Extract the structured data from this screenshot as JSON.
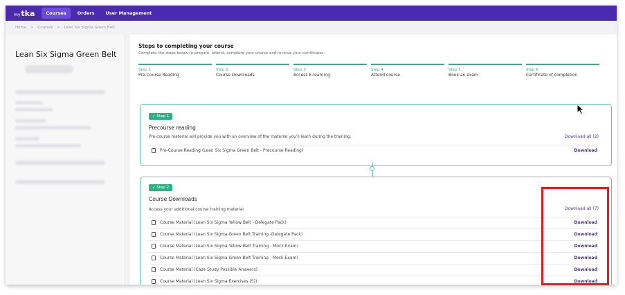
{
  "nav": {
    "logo_small": "my",
    "logo_main": "tka",
    "items": [
      {
        "label": "Courses",
        "active": true
      },
      {
        "label": "Orders",
        "active": false
      },
      {
        "label": "User Management",
        "active": false
      }
    ]
  },
  "breadcrumb": [
    "Home",
    ">",
    "Courses",
    ">",
    "Lean Six Sigma Green Belt"
  ],
  "sidebar": {
    "course_title": "Lean Six Sigma Green Belt"
  },
  "steps": {
    "title": "Steps to completing your course",
    "subtitle": "Complete the steps below to prepare, attend, complete your course and receive your certificates.",
    "items": [
      {
        "num": "Step 1",
        "name": "Pre-Course Reading"
      },
      {
        "num": "Step 2",
        "name": "Course Downloads"
      },
      {
        "num": "Step 3",
        "name": "Access E-learning"
      },
      {
        "num": "Step 4",
        "name": "Attend course"
      },
      {
        "num": "Step 5",
        "name": "Book an exam"
      },
      {
        "num": "Step 6",
        "name": "Certificate of completion"
      }
    ]
  },
  "card1": {
    "badge": "✓ Step 1",
    "title": "Precourse reading",
    "desc": "Pre-course material will provide you with an overview of the material you'll learn during the training.",
    "download_all": "Download all (2)",
    "files": [
      {
        "name": "Pre-Course Reading (Lean Six Sigma Green Belt - Precourse Reading)",
        "action": "Download"
      }
    ]
  },
  "card2": {
    "badge": "✓ Step 2",
    "title": "Course Downloads",
    "desc": "Access your additional course training material.",
    "download_all": "Download all (7)",
    "files": [
      {
        "name": "Course Material (Lean Six Sigma Yellow Belt - Delegate Pack)",
        "action": "Download"
      },
      {
        "name": "Course Material (Lean Six Sigma Green Belt Training -Delegate Pack)",
        "action": "Download"
      },
      {
        "name": "Course Material (Lean Six Sigma Yellow Belt Training - Mock Exam)",
        "action": "Download"
      },
      {
        "name": "Course Material (Lean Six Sigma Green Belt Training - Mock Exam)",
        "action": "Download"
      },
      {
        "name": "Course Material (Case Study Possible Answers)",
        "action": "Download"
      },
      {
        "name": "Course Material (Lean Six Sigma Exercises (5))",
        "action": "Download"
      }
    ]
  },
  "colors": {
    "brand": "#4a2bb0",
    "accent": "#27b585",
    "highlight": "#e11d1d"
  }
}
